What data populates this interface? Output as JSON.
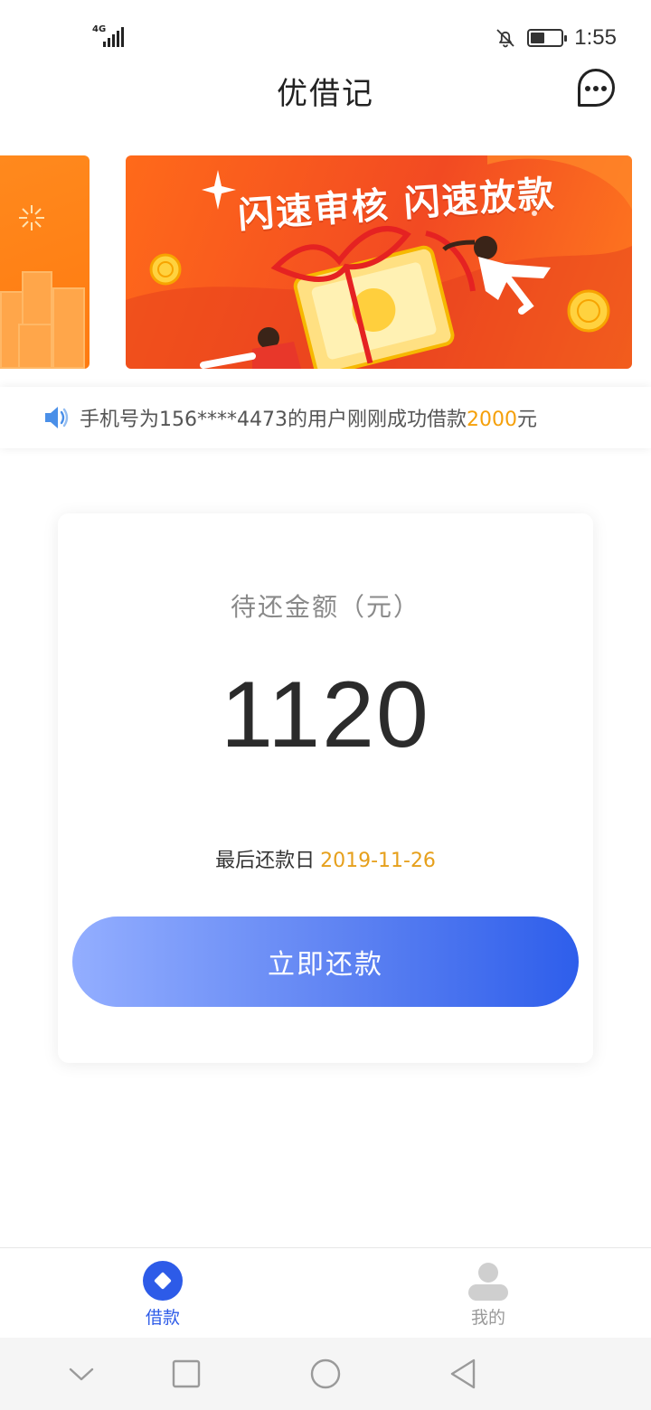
{
  "status_bar": {
    "network": "4G",
    "time": "1:55",
    "battery_level": 0.4
  },
  "header": {
    "title": "优借记",
    "menu_icon": "chat-bubble-more-icon"
  },
  "banner": {
    "headline": "闪速审核 闪速放款",
    "colors": {
      "primary": "#f24a22",
      "accent": "#ff8a1e"
    }
  },
  "ticker": {
    "prefix": "手机号为156****4473的用户刚刚成功借款",
    "amount": "2000",
    "suffix": "元",
    "icon": "speaker-icon"
  },
  "repayment_card": {
    "label": "待还金额（元）",
    "amount": "1120",
    "due_label": "最后还款日",
    "due_date": "2019-11-26",
    "button_label": "立即还款"
  },
  "tab_bar": {
    "tabs": [
      {
        "label": "借款",
        "icon": "loan-diamond-icon",
        "active": true
      },
      {
        "label": "我的",
        "icon": "user-profile-icon",
        "active": false
      }
    ],
    "active_color": "#2d5be8"
  },
  "system_nav": {
    "buttons": [
      "nav-down-icon",
      "nav-recents-icon",
      "nav-home-icon",
      "nav-back-icon"
    ]
  }
}
